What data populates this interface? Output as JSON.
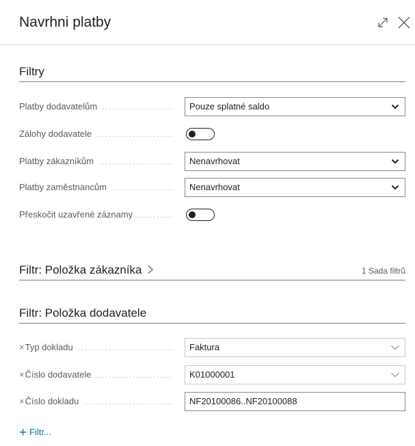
{
  "window": {
    "title": "Navrhni platby"
  },
  "filters": {
    "title": "Filtry",
    "rows": [
      {
        "label": "Platby dodavatelům",
        "value": "Pouze splatné saldo"
      },
      {
        "label": "Zálohy dodavatele",
        "toggle_on": false
      },
      {
        "label": "Platby zákazníkům",
        "value": "Nenavrhovat"
      },
      {
        "label": "Platby zaměstnancům",
        "value": "Nenavrhovat"
      },
      {
        "label": "Přeskočit uzavřené záznamy",
        "toggle_on": false
      }
    ]
  },
  "customer_filter": {
    "title": "Filtr: Položka zákazníka",
    "count_text": "1 Sada filtrů"
  },
  "vendor_filter": {
    "title": "Filtr: Položka dodavatele",
    "remove_glyph": "×",
    "rows": [
      {
        "label": "Typ dokladu",
        "value": "Faktura"
      },
      {
        "label": "Číslo dodavatele",
        "value": "K01000001"
      },
      {
        "label": "Číslo dokladu",
        "value": "NF20100086..NF20100088"
      }
    ],
    "add_filter_label": "Filtr..."
  },
  "icons": [
    "expand-icon",
    "close-icon",
    "chevron-down-icon",
    "chevron-right-icon",
    "remove-filter-icon",
    "plus-icon"
  ],
  "colors": {
    "accent": "#00759c",
    "text": "#212121",
    "label": "#5b5b5b"
  }
}
